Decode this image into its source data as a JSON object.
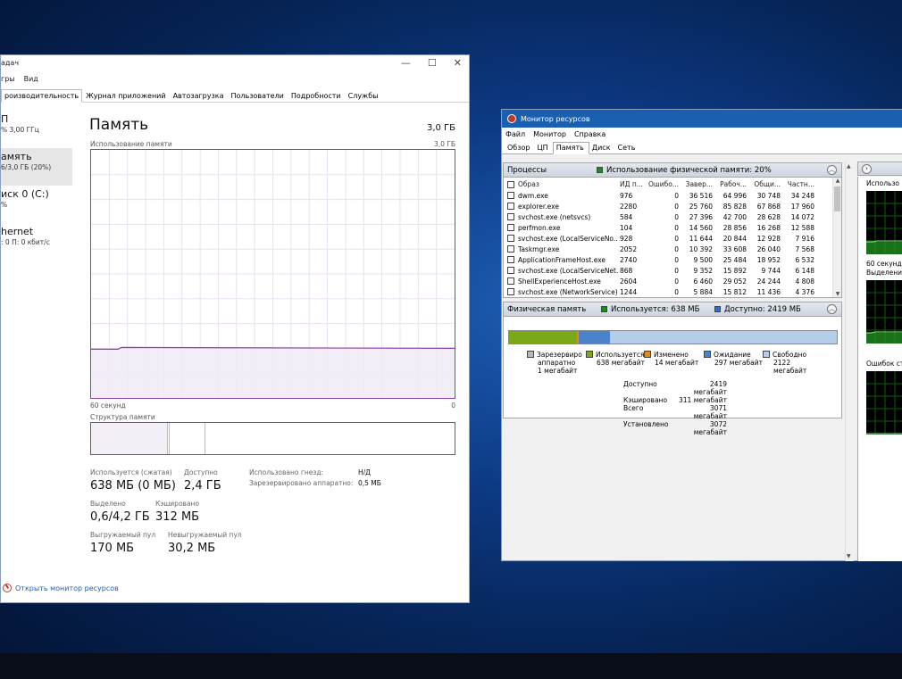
{
  "task_manager": {
    "title_partial": "адач",
    "caption_buttons": [
      "—",
      "☐",
      "✕"
    ],
    "menu": [
      "гры",
      "Вид"
    ],
    "tabs": [
      "роизводительность",
      "Журнал приложений",
      "Автозагрузка",
      "Пользователи",
      "Подробности",
      "Службы"
    ],
    "sidebar": [
      {
        "name": "П",
        "sub": "% 3,00 ГГц"
      },
      {
        "name": "амять",
        "sub": "6/3,0 ГБ (20%)"
      },
      {
        "name": "иск 0 (C:)",
        "sub": "%"
      },
      {
        "name": "hernet",
        "sub": ": 0 П: 0 кбит/с"
      }
    ],
    "memory": {
      "title": "Память",
      "total": "3,0 ГБ",
      "usage_label": "Использование памяти",
      "usage_max": "3,0 ГБ",
      "axis_left": "60 секунд",
      "axis_right": "0",
      "structure_label": "Структура памяти",
      "usage_fraction": 0.2
    },
    "stats": {
      "in_use_label": "Используется (сжатая)",
      "in_use_value": "638 МБ (0 МБ)",
      "available_label": "Доступно",
      "available_value": "2,4 ГБ",
      "committed_label": "Выделено",
      "committed_value": "0,6/4,2 ГБ",
      "cached_label": "Кэшировано",
      "cached_value": "312 МБ",
      "paged_label": "Выгружаемый пул",
      "paged_value": "170 МБ",
      "nonpaged_label": "Невыгружаемый пул",
      "nonpaged_value": "30,2 МБ",
      "slots_label": "Использовано гнезд:",
      "slots_value": "Н/Д",
      "reserved_label": "Зарезервировано аппаратно:",
      "reserved_value": "0,5 МБ"
    },
    "open_monitor_link": "Открыть монитор ресурсов"
  },
  "resource_monitor": {
    "title": "Монитор ресурсов",
    "menu": [
      "Файл",
      "Монитор",
      "Справка"
    ],
    "tabs": [
      "Обзор",
      "ЦП",
      "Память",
      "Диск",
      "Сеть"
    ],
    "active_tab": "Память",
    "processes": {
      "title": "Процессы",
      "legend_text": "Использование физической памяти: 20%",
      "legend_color": "#1e8c1e",
      "columns": [
        "Образ",
        "ИД п...",
        "Ошибо...",
        "Завер...",
        "Рабоч...",
        "Общи...",
        "Частн..."
      ],
      "rows": [
        [
          "dwm.exe",
          "976",
          "0",
          "36 516",
          "64 996",
          "30 748",
          "34 248"
        ],
        [
          "explorer.exe",
          "2280",
          "0",
          "25 760",
          "85 828",
          "67 868",
          "17 960"
        ],
        [
          "svchost.exe (netsvcs)",
          "584",
          "0",
          "27 396",
          "42 700",
          "28 628",
          "14 072"
        ],
        [
          "perfmon.exe",
          "104",
          "0",
          "14 560",
          "28 856",
          "16 268",
          "12 588"
        ],
        [
          "svchost.exe (LocalServiceNo...",
          "928",
          "0",
          "11 644",
          "20 844",
          "12 928",
          "7 916"
        ],
        [
          "Taskmgr.exe",
          "2052",
          "0",
          "10 392",
          "33 608",
          "26 040",
          "7 568"
        ],
        [
          "ApplicationFrameHost.exe",
          "2740",
          "0",
          "9 500",
          "25 484",
          "18 952",
          "6 532"
        ],
        [
          "svchost.exe (LocalServiceNet...",
          "868",
          "0",
          "9 352",
          "15 892",
          "9 744",
          "6 148"
        ],
        [
          "ShellExperienceHost.exe",
          "2604",
          "0",
          "6 460",
          "29 052",
          "24 244",
          "4 808"
        ],
        [
          "svchost.exe (NetworkService)",
          "1244",
          "0",
          "5 884",
          "15 812",
          "11 436",
          "4 376"
        ]
      ]
    },
    "physical_memory": {
      "title": "Физическая память",
      "in_use_text": "Используется: 638 МБ",
      "in_use_color": "#1e8c1e",
      "available_text": "Доступно: 2419 МБ",
      "available_color": "#2b6fd6",
      "bar": [
        {
          "name": "reserved",
          "mb": 1,
          "color": "#9a9a9a"
        },
        {
          "name": "in_use",
          "mb": 638,
          "color": "#7aa817"
        },
        {
          "name": "modified",
          "mb": 14,
          "color": "#e08a1a"
        },
        {
          "name": "standby",
          "mb": 297,
          "color": "#4a82cc"
        },
        {
          "name": "free",
          "mb": 2122,
          "color": "#b4cde8"
        }
      ],
      "legend": [
        {
          "label": "Зарезервиро",
          "line2": "аппаратно",
          "line3": "1 мегабайт",
          "color": "#b8b8b8"
        },
        {
          "label": "Используется",
          "line2": "638 мегабайт",
          "line3": "",
          "color": "#7aa817"
        },
        {
          "label": "Изменено",
          "line2": "14 мегабайт",
          "line3": "",
          "color": "#e08a1a"
        },
        {
          "label": "Ожидание",
          "line2": "297 мегабайт",
          "line3": "",
          "color": "#4a82cc"
        },
        {
          "label": "Свободно",
          "line2": "2122",
          "line3": "мегабайт",
          "color": "#b4cde8"
        }
      ],
      "summary": [
        {
          "label": "Доступно",
          "value": "2419 мегабайт"
        },
        {
          "label": "Кэшировано",
          "value": "311 мегабайт"
        },
        {
          "label": "Всего",
          "value": "3071 мегабайт"
        },
        {
          "label": "Установлено",
          "value": "3072 мегабайт"
        }
      ]
    },
    "right_panel": {
      "label1": "Использо",
      "label2": "60 секунд",
      "label3": "Выделение",
      "label4": "Ошибок ст"
    }
  }
}
